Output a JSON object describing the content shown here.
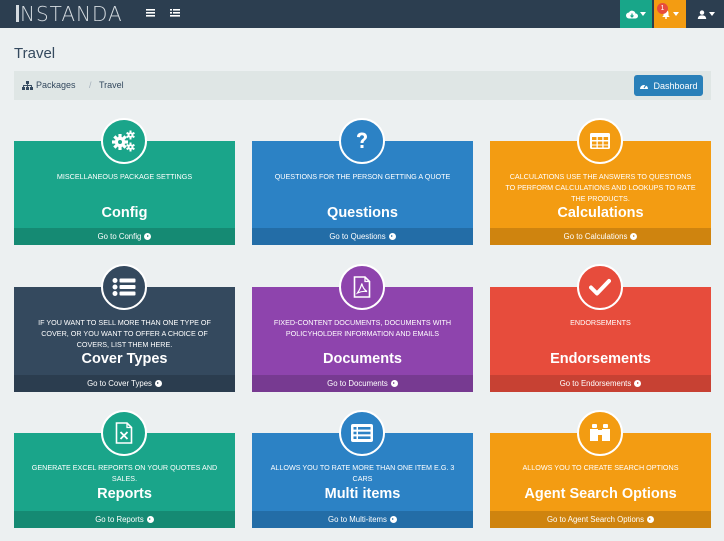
{
  "brand": {
    "logo_text": "NSTANDA"
  },
  "topbar": {
    "menu_icon": "hamburger-icon",
    "list_icon": "list-icon",
    "cloud_icon": "cloud-download-icon",
    "bell_icon": "bell-icon",
    "notification_count": "1",
    "user_icon": "user-icon"
  },
  "page": {
    "title": "Travel"
  },
  "breadcrumb": {
    "packages": "Packages",
    "separator": "/",
    "current": "Travel",
    "dashboard_button": "Dashboard"
  },
  "tiles": [
    {
      "title": "Config",
      "description": "MISCELLANEOUS PACKAGE SETTINGS",
      "link": "Go to Config",
      "icon": "cogs-icon",
      "color": "#1aa58a"
    },
    {
      "title": "Questions",
      "description": "QUESTIONS FOR THE PERSON GETTING A QUOTE",
      "link": "Go to Questions",
      "icon": "question-icon",
      "color": "#2c82c5"
    },
    {
      "title": "Calculations",
      "description": "CALCULATIONS USE THE ANSWERS TO QUESTIONS TO PERFORM CALCULATIONS AND LOOKUPS TO RATE THE PRODUCTS.",
      "link": "Go to Calculations",
      "icon": "table-icon",
      "color": "#f39c12"
    },
    {
      "title": "Cover Types",
      "description": "IF YOU WANT TO SELL MORE THAN ONE TYPE OF COVER, OR YOU WANT TO OFFER A CHOICE OF COVERS, LIST THEM HERE.",
      "link": "Go to Cover Types",
      "icon": "list-icon",
      "color": "#34495e"
    },
    {
      "title": "Documents",
      "description": "FIXED-CONTENT DOCUMENTS, DOCUMENTS WITH POLICYHOLDER INFORMATION AND EMAILS",
      "link": "Go to Documents",
      "icon": "pdf-file-icon",
      "color": "#8e44ad"
    },
    {
      "title": "Endorsements",
      "description": "ENDORSEMENTS",
      "link": "Go to Endorsements",
      "icon": "check-icon",
      "color": "#e74c3c"
    },
    {
      "title": "Reports",
      "description": "GENERATE EXCEL REPORTS ON YOUR QUOTES AND SALES.",
      "link": "Go to Reports",
      "icon": "excel-file-icon",
      "color": "#1aa58a"
    },
    {
      "title": "Multi items",
      "description": "ALLOWS YOU TO RATE MORE THAN ONE ITEM E.G. 3 CARS",
      "link": "Go to Multi-items",
      "icon": "list-alt-icon",
      "color": "#2c82c5"
    },
    {
      "title": "Agent Search Options",
      "description": "ALLOWS YOU TO CREATE SEARCH OPTIONS",
      "link": "Go to Agent Search Options",
      "icon": "binoculars-icon",
      "color": "#f39c12"
    }
  ]
}
